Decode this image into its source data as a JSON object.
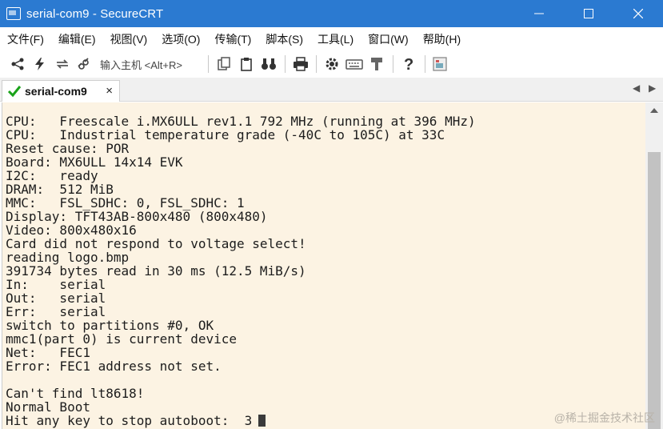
{
  "window": {
    "title": "serial-com9 - SecureCRT"
  },
  "menu": [
    "文件(F)",
    "编辑(E)",
    "视图(V)",
    "选项(O)",
    "传输(T)",
    "脚本(S)",
    "工具(L)",
    "窗口(W)",
    "帮助(H)"
  ],
  "toolbar": {
    "connect_placeholder": "输入主机 <Alt+R>"
  },
  "tab": {
    "label": "serial-com9",
    "close": "×"
  },
  "terminal": {
    "lines": [
      "CPU:   Freescale i.MX6ULL rev1.1 792 MHz (running at 396 MHz)",
      "CPU:   Industrial temperature grade (-40C to 105C) at 33C",
      "Reset cause: POR",
      "Board: MX6ULL 14x14 EVK",
      "I2C:   ready",
      "DRAM:  512 MiB",
      "MMC:   FSL_SDHC: 0, FSL_SDHC: 1",
      "Display: TFT43AB-800x480 (800x480)",
      "Video: 800x480x16",
      "Card did not respond to voltage select!",
      "reading logo.bmp",
      "391734 bytes read in 30 ms (12.5 MiB/s)",
      "In:    serial",
      "Out:   serial",
      "Err:   serial",
      "switch to partitions #0, OK",
      "mmc1(part 0) is current device",
      "Net:   FEC1",
      "Error: FEC1 address not set.",
      "",
      "Can't find lt8618!",
      "Normal Boot",
      "Hit any key to stop autoboot:  3"
    ]
  },
  "watermark": "@稀土掘金技术社区",
  "colors": {
    "titlebar": "#2b7ad1",
    "terminal_bg": "#fcf3e3",
    "check_green": "#1aa31a"
  }
}
